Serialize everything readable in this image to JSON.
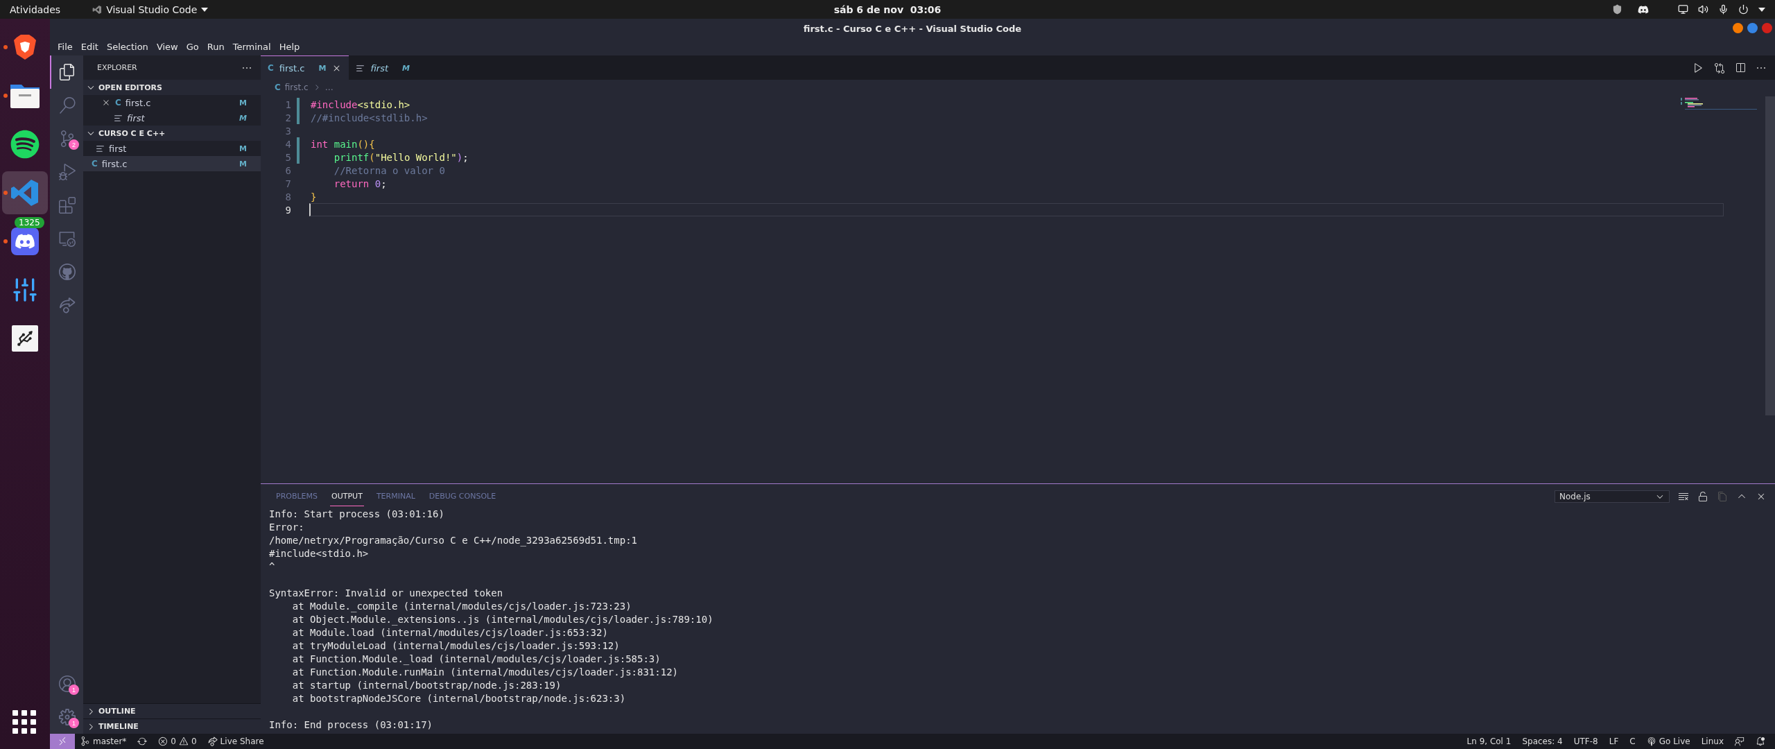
{
  "top_bar": {
    "activities": "Atividades",
    "app_menu": "Visual Studio Code",
    "clock": "sáb 6 de nov  03:06"
  },
  "dock": {
    "apps": [
      {
        "kind": "brave",
        "running": true,
        "selected": false
      },
      {
        "kind": "files",
        "running": true,
        "selected": false
      },
      {
        "kind": "spotify",
        "running": false,
        "selected": false
      },
      {
        "kind": "vscode",
        "running": true,
        "selected": true
      },
      {
        "kind": "discord",
        "running": true,
        "selected": false,
        "badge": "1325"
      },
      {
        "kind": "mixer",
        "running": false,
        "selected": false
      },
      {
        "kind": "usb",
        "running": false,
        "selected": false
      }
    ]
  },
  "window": {
    "title": "first.c - Curso C e C++ - Visual Studio Code"
  },
  "menu": [
    "File",
    "Edit",
    "Selection",
    "View",
    "Go",
    "Run",
    "Terminal",
    "Help"
  ],
  "activity_bar": {
    "items": [
      {
        "kind": "explorer",
        "selected": true
      },
      {
        "kind": "search",
        "selected": false
      },
      {
        "kind": "source-control",
        "selected": false,
        "badge": "2"
      },
      {
        "kind": "run",
        "selected": false
      },
      {
        "kind": "extensions",
        "selected": false
      },
      {
        "kind": "remote",
        "selected": false
      },
      {
        "kind": "github",
        "selected": false
      },
      {
        "kind": "live-share",
        "selected": false
      }
    ],
    "bottom": [
      {
        "kind": "accounts",
        "badge": "1"
      },
      {
        "kind": "settings",
        "badge": "1"
      }
    ]
  },
  "sidebar": {
    "title": "EXPLORER",
    "sections": [
      {
        "title": "OPEN EDITORS",
        "expanded": true,
        "items": [
          {
            "name": "first.c",
            "kind": "c",
            "icon": "C",
            "status": "M",
            "preview": false,
            "selected": false,
            "closable": true
          },
          {
            "name": "first",
            "kind": "text",
            "status": "M",
            "preview": true,
            "selected": false,
            "closable": false
          }
        ]
      },
      {
        "title": "CURSO C E C++",
        "expanded": true,
        "items": [
          {
            "name": "first",
            "kind": "text",
            "status": "M",
            "preview": false,
            "selected": false,
            "closable": false
          },
          {
            "name": "first.c",
            "kind": "c",
            "icon": "C",
            "status": "M",
            "preview": false,
            "selected": true,
            "closable": false
          }
        ]
      }
    ],
    "footer": [
      {
        "title": "OUTLINE",
        "expanded": false
      },
      {
        "title": "TIMELINE",
        "expanded": false
      }
    ]
  },
  "editor": {
    "tabs": [
      {
        "label": "first.c",
        "kind": "c",
        "icon": "C",
        "status": "M",
        "selected": true,
        "preview": false
      },
      {
        "label": "first",
        "kind": "text",
        "status": "M",
        "selected": false,
        "preview": true
      }
    ],
    "breadcrumb": {
      "icon": "C",
      "file": "first.c",
      "rest": "…"
    },
    "lines": [
      {
        "number": "1",
        "changed": true,
        "current": false,
        "tokens": [
          {
            "kind": "keyword",
            "text": "#include"
          },
          {
            "kind": "string",
            "text": "<stdio.h>"
          }
        ]
      },
      {
        "number": "2",
        "changed": true,
        "current": false,
        "tokens": [
          {
            "kind": "comment",
            "text": "//#include<stdlib.h>"
          }
        ]
      },
      {
        "number": "3",
        "changed": false,
        "current": false
      },
      {
        "number": "4",
        "changed": true,
        "current": false,
        "tokens": [
          {
            "kind": "keyword",
            "text": "int "
          },
          {
            "kind": "function",
            "text": "main"
          },
          {
            "kind": "brace",
            "text": "(){"
          }
        ]
      },
      {
        "number": "5",
        "changed": true,
        "current": false,
        "tokens": [
          {
            "kind": "function",
            "text": "    printf"
          },
          {
            "kind": "brace",
            "text": "("
          },
          {
            "kind": "string",
            "text": "\"Hello World!\""
          },
          {
            "kind": "paren",
            "text": ")"
          },
          {
            "kind": "plain",
            "text": ";"
          }
        ]
      },
      {
        "number": "6",
        "changed": false,
        "current": false,
        "tokens": [
          {
            "kind": "comment",
            "text": "    //Retorna o valor 0"
          }
        ]
      },
      {
        "number": "7",
        "changed": false,
        "current": false,
        "tokens": [
          {
            "kind": "keyword",
            "text": "    return "
          },
          {
            "kind": "number",
            "text": "0"
          },
          {
            "kind": "plain",
            "text": ";"
          }
        ]
      },
      {
        "number": "8",
        "changed": false,
        "current": false,
        "tokens": [
          {
            "kind": "brace",
            "text": "}"
          }
        ]
      },
      {
        "number": "9",
        "changed": false,
        "current": true
      }
    ]
  },
  "panel": {
    "tabs": [
      {
        "label": "PROBLEMS",
        "selected": false
      },
      {
        "label": "OUTPUT",
        "selected": true
      },
      {
        "label": "TERMINAL",
        "selected": false
      },
      {
        "label": "DEBUG CONSOLE",
        "selected": false
      }
    ],
    "channel": "Node.js",
    "blocks": [
      {
        "lines": [
          "Info: Start process (03:01:16)",
          "Error:",
          "/home/netryx/Programação/Curso C e C++/node_3293a62569d51.tmp:1",
          "#include<stdio.h>",
          "^"
        ]
      },
      {
        "lines": [
          "SyntaxError: Invalid or unexpected token",
          "    at Module._compile (internal/modules/cjs/loader.js:723:23)",
          "    at Object.Module._extensions..js (internal/modules/cjs/loader.js:789:10)",
          "    at Module.load (internal/modules/cjs/loader.js:653:32)",
          "    at tryModuleLoad (internal/modules/cjs/loader.js:593:12)",
          "    at Function.Module._load (internal/modules/cjs/loader.js:585:3)",
          "    at Function.Module.runMain (internal/modules/cjs/loader.js:831:12)",
          "    at startup (internal/bootstrap/node.js:283:19)",
          "    at bootstrapNodeJSCore (internal/bootstrap/node.js:623:3)"
        ]
      },
      {
        "lines": [
          "Info: End process (03:01:17)"
        ]
      }
    ]
  },
  "status_bar": {
    "branch": "master*",
    "errors": "0",
    "warnings": "0",
    "live_share": "Live Share",
    "right": [
      "Ln 9, Col 1",
      "Spaces: 4",
      "UTF-8",
      "LF",
      "C"
    ],
    "go_live": "Go Live",
    "os": "Linux"
  }
}
